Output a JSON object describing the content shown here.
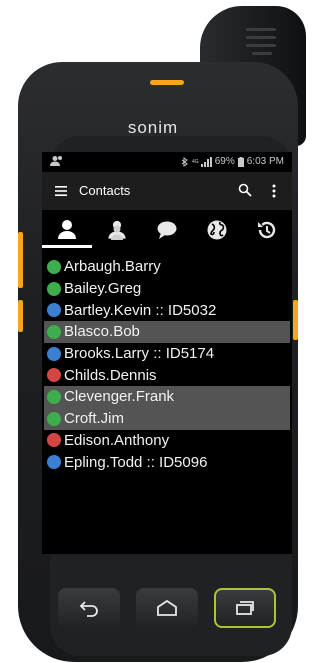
{
  "device": {
    "brand": "sonim"
  },
  "status_bar": {
    "battery": "69%",
    "time": "6:03 PM"
  },
  "app_bar": {
    "title": "Contacts"
  },
  "tabs": [
    {
      "icon": "person-icon",
      "active": true
    },
    {
      "icon": "group-icon",
      "active": false
    },
    {
      "icon": "chat-bubble-icon",
      "active": false
    },
    {
      "icon": "globe-icon",
      "active": false
    },
    {
      "icon": "history-icon",
      "active": false
    }
  ],
  "contacts": [
    {
      "name": "Arbaugh.Barry",
      "status_color": "#3dad4d",
      "selected": false
    },
    {
      "name": "Bailey.Greg",
      "status_color": "#3dad4d",
      "selected": false
    },
    {
      "name": "Bartley.Kevin :: ID5032",
      "status_color": "#3a7fd1",
      "selected": false
    },
    {
      "name": "Blasco.Bob",
      "status_color": "#3dad4d",
      "selected": true
    },
    {
      "name": "Brooks.Larry :: ID5174",
      "status_color": "#3a7fd1",
      "selected": false
    },
    {
      "name": "Childs.Dennis",
      "status_color": "#d64545",
      "selected": false
    },
    {
      "name": "Clevenger.Frank",
      "status_color": "#3dad4d",
      "selected": true
    },
    {
      "name": "Croft.Jim",
      "status_color": "#3dad4d",
      "selected": true
    },
    {
      "name": "Edison.Anthony",
      "status_color": "#d64545",
      "selected": false
    },
    {
      "name": "Epling.Todd :: ID5096",
      "status_color": "#3a7fd1",
      "selected": false
    }
  ],
  "colors": {
    "accent_keys": "#f2a81a",
    "recent_key": "#a6c63a"
  }
}
